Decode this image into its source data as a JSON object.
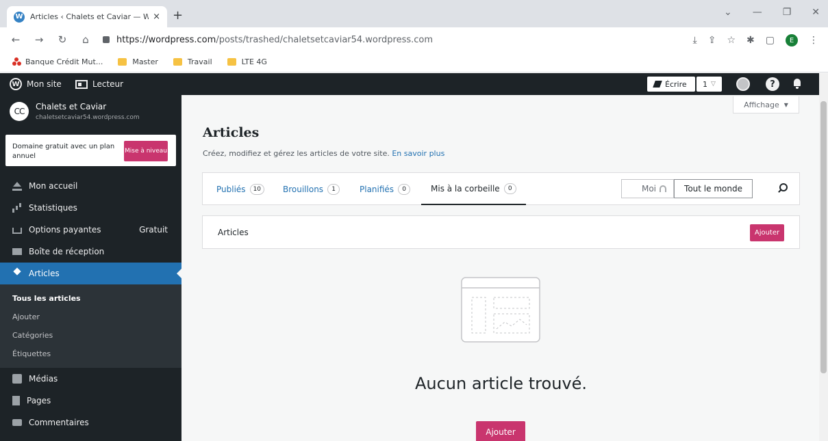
{
  "browser": {
    "tab_title": "Articles ‹ Chalets et Caviar — Wo",
    "tab_close": "×",
    "new_tab": "+",
    "url_host": "https://wordpress.com",
    "url_path": "/posts/trashed/chaletsetcaviar54.wordpress.com",
    "profile_initial": "E",
    "bookmarks": [
      {
        "label": "Banque Crédit Mut..."
      },
      {
        "label": "Master"
      },
      {
        "label": "Travail"
      },
      {
        "label": "LTE 4G"
      }
    ]
  },
  "adminbar": {
    "my_site": "Mon site",
    "reader": "Lecteur",
    "write": "Écrire",
    "count": "1",
    "help": "?"
  },
  "sidebar": {
    "site_initials": "CC",
    "site_name": "Chalets et Caviar",
    "site_url": "chaletsetcaviar54.wordpress.com",
    "upsell_text": "Domaine gratuit avec un plan annuel",
    "upsell_button": "Mise à niveau",
    "items": [
      {
        "label": "Mon accueil"
      },
      {
        "label": "Statistiques"
      },
      {
        "label": "Options payantes",
        "extra": "Gratuit"
      },
      {
        "label": "Boîte de réception"
      },
      {
        "label": "Articles"
      },
      {
        "label": "Médias"
      },
      {
        "label": "Pages"
      },
      {
        "label": "Commentaires"
      }
    ],
    "submenu": [
      {
        "label": "Tous les articles"
      },
      {
        "label": "Ajouter"
      },
      {
        "label": "Catégories"
      },
      {
        "label": "Étiquettes"
      }
    ]
  },
  "main": {
    "view_button": "Affichage",
    "title": "Articles",
    "subtitle": "Créez, modifiez et gérez les articles de votre site.",
    "learn_more": "En savoir plus",
    "tabs": [
      {
        "label": "Publiés",
        "count": "10"
      },
      {
        "label": "Brouillons",
        "count": "1"
      },
      {
        "label": "Planifiés",
        "count": "0"
      },
      {
        "label": "Mis à la corbeille",
        "count": "0"
      }
    ],
    "filter_me": "Moi",
    "filter_all": "Tout le monde",
    "list_label": "Articles",
    "add_button": "Ajouter",
    "empty_title": "Aucun article trouvé.",
    "empty_button": "Ajouter"
  },
  "colors": {
    "accent_pink": "#c9356e",
    "link_blue": "#2271b1",
    "sidebar_bg": "#1d2327"
  }
}
